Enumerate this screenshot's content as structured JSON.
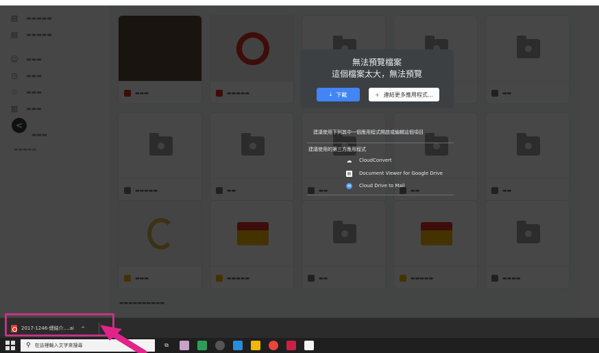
{
  "preview": {
    "title": "無法預覽檔案",
    "subtitle": "這個檔案太大，無法預覽",
    "download_label": "下載",
    "connect_label": "連結更多應用程式…"
  },
  "suggestions": {
    "headline": "建議使用下列其中一個應用程式開啟或編輯這個項目",
    "third_party_label": "建議使用的第三方應用程式",
    "apps": [
      {
        "label": "CloudConvert",
        "icon": "cloud-icon"
      },
      {
        "label": "Document Viewer for Google Drive",
        "icon": "document-icon"
      },
      {
        "label": "Cloud Drive to Mail",
        "icon": "mail-icon"
      }
    ]
  },
  "download_shelf": {
    "file_name": "2017-1246-總結介....ai",
    "chevron": "^"
  },
  "taskbar": {
    "search_placeholder": "在這裡輸入文字來搜尋"
  },
  "colors": {
    "overlay": "#000000",
    "download_button": "#4285f4",
    "highlight": "#c13584",
    "card": "#3c4043"
  }
}
